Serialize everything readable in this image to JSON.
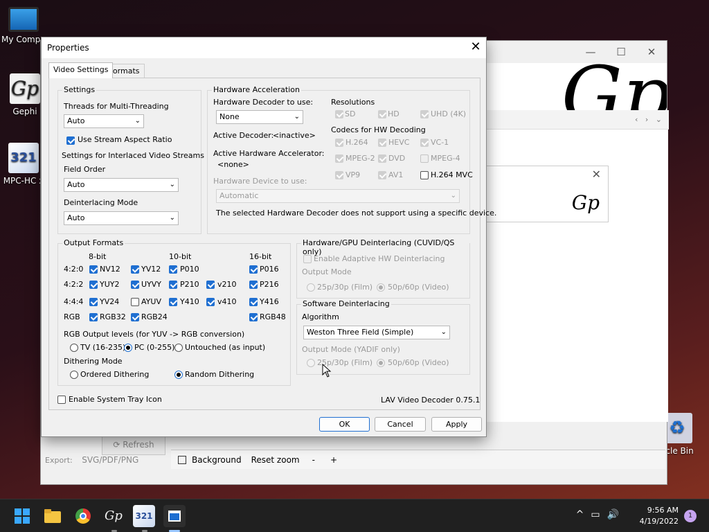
{
  "desktop": {
    "icons": [
      {
        "label": "My Compu",
        "glyph": "computer-icon"
      },
      {
        "label": "Gephi",
        "glyph": "Gp"
      },
      {
        "label": "MPC-HC x",
        "glyph": "321"
      },
      {
        "label": "ycle Bin",
        "glyph": "♻"
      }
    ]
  },
  "bg_app": {
    "refresh_label": "Refresh",
    "export_label": "Export:",
    "export_formats": "SVG/PDF/PNG",
    "background_label": "Background",
    "reset_zoom_label": "Reset zoom",
    "zoom_out": "-",
    "zoom_in": "+",
    "logo_text": "Gp"
  },
  "dialog": {
    "title": "Properties",
    "tabs": [
      "Video Settings",
      "Formats"
    ],
    "settings": {
      "legend": "Settings",
      "threads_label": "Threads for Multi-Threading",
      "threads_value": "Auto",
      "stream_aspect_label": "Use Stream Aspect Ratio",
      "stream_aspect_checked": true,
      "interlaced_label": "Settings for Interlaced Video Streams",
      "field_order_label": "Field Order",
      "field_order_value": "Auto",
      "deint_mode_label": "Deinterlacing Mode",
      "deint_mode_value": "Auto"
    },
    "hwaccel": {
      "legend": "Hardware Acceleration",
      "decoder_label": "Hardware Decoder to use:",
      "decoder_value": "None",
      "active_decoder_label": "Active Decoder:",
      "active_decoder_value": "<inactive>",
      "active_accel_label": "Active Hardware Accelerator:",
      "active_accel_value": "<none>",
      "device_label": "Hardware Device to use:",
      "device_value": "Automatic",
      "note": "The selected Hardware Decoder does not support using a specific device.",
      "resolutions_label": "Resolutions",
      "resolutions": [
        {
          "label": "SD",
          "checked": true
        },
        {
          "label": "HD",
          "checked": true
        },
        {
          "label": "UHD (4K)",
          "checked": true
        }
      ],
      "codecs_label": "Codecs for HW Decoding",
      "codecs": [
        {
          "label": "H.264",
          "checked": true,
          "enabled": false
        },
        {
          "label": "HEVC",
          "checked": true,
          "enabled": false
        },
        {
          "label": "VC-1",
          "checked": true,
          "enabled": false
        },
        {
          "label": "MPEG-2",
          "checked": true,
          "enabled": false
        },
        {
          "label": "DVD",
          "checked": true,
          "enabled": false
        },
        {
          "label": "MPEG-4",
          "checked": false,
          "enabled": false
        },
        {
          "label": "VP9",
          "checked": true,
          "enabled": false
        },
        {
          "label": "AV1",
          "checked": true,
          "enabled": false
        },
        {
          "label": "H.264 MVC",
          "checked": false,
          "enabled": true
        }
      ]
    },
    "output": {
      "legend": "Output Formats",
      "col_headers": [
        "8-bit",
        "10-bit",
        "16-bit"
      ],
      "rows": [
        {
          "label": "4:2:0",
          "items": [
            {
              "t": "NV12",
              "c": true
            },
            {
              "t": "YV12",
              "c": true
            },
            {
              "t": "P010",
              "c": true
            },
            {
              "t": "P016",
              "c": true
            }
          ]
        },
        {
          "label": "4:2:2",
          "items": [
            {
              "t": "YUY2",
              "c": true
            },
            {
              "t": "UYVY",
              "c": true
            },
            {
              "t": "P210",
              "c": true
            },
            {
              "t": "v210",
              "c": true
            },
            {
              "t": "P216",
              "c": true
            }
          ]
        },
        {
          "label": "4:4:4",
          "items": [
            {
              "t": "YV24",
              "c": true
            },
            {
              "t": "AYUV",
              "c": false
            },
            {
              "t": "Y410",
              "c": true
            },
            {
              "t": "v410",
              "c": true
            },
            {
              "t": "Y416",
              "c": true
            }
          ]
        },
        {
          "label": "RGB",
          "items": [
            {
              "t": "RGB32",
              "c": true
            },
            {
              "t": "RGB24",
              "c": true
            },
            {
              "t": "RGB48",
              "c": true
            }
          ]
        }
      ],
      "rgb_levels_label": "RGB Output levels (for YUV -> RGB conversion)",
      "rgb_levels": [
        "TV (16-235)",
        "PC (0-255)",
        "Untouched (as input)"
      ],
      "rgb_levels_selected": "PC (0-255)",
      "dither_label": "Dithering Mode",
      "dither_options": [
        "Ordered Dithering",
        "Random Dithering"
      ],
      "dither_selected": "Random Dithering"
    },
    "hwdeint": {
      "legend": "Hardware/GPU Deinterlacing (CUVID/QS only)",
      "adaptive_label": "Enable Adaptive HW Deinterlacing",
      "output_mode_label": "Output Mode",
      "options": [
        "25p/30p (Film)",
        "50p/60p (Video)"
      ],
      "selected": "50p/60p (Video)"
    },
    "swdeint": {
      "legend": "Software Deinterlacing",
      "algorithm_label": "Algorithm",
      "algorithm_value": "Weston Three Field (Simple)",
      "output_mode_label": "Output Mode (YADIF only)",
      "options": [
        "25p/30p (Film)",
        "50p/60p (Video)"
      ],
      "selected": "50p/60p (Video)"
    },
    "tray_label": "Enable System Tray Icon",
    "version": "LAV Video Decoder 0.75.1",
    "buttons": {
      "ok": "OK",
      "cancel": "Cancel",
      "apply": "Apply"
    }
  },
  "taskbar": {
    "time": "9:56 AM",
    "date": "4/19/2022",
    "notifications": "1",
    "mpc_badge": "321"
  },
  "colors": {
    "accent": "#1f6fd1",
    "taskbar": "#202020"
  }
}
